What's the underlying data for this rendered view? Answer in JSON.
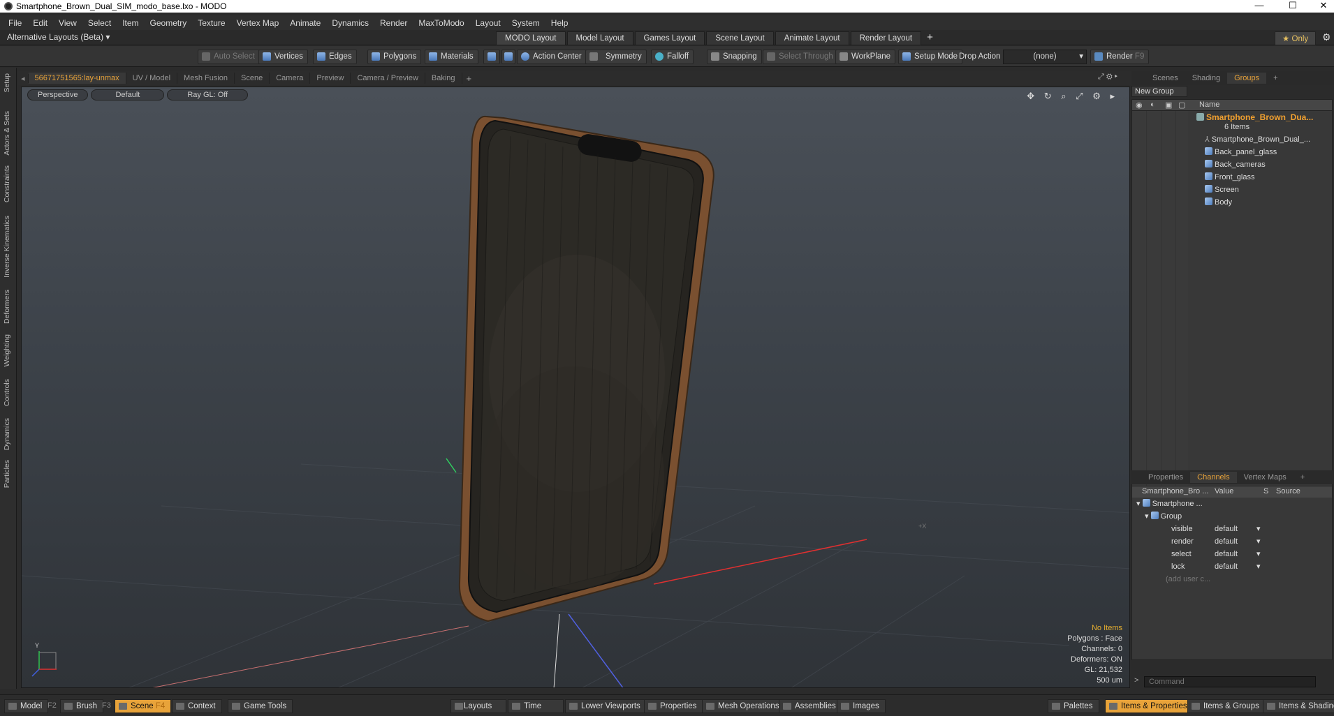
{
  "window": {
    "title": "Smartphone_Brown_Dual_SIM_modo_base.lxo - MODO",
    "controls": [
      "—",
      "☐",
      "✕"
    ]
  },
  "menu": [
    "File",
    "Edit",
    "View",
    "Select",
    "Item",
    "Geometry",
    "Texture",
    "Vertex Map",
    "Animate",
    "Dynamics",
    "Render",
    "MaxToModo",
    "Layout",
    "System",
    "Help"
  ],
  "layoutbar": {
    "alt_layouts": "Alternative Layouts (Beta) ▾",
    "tabs": [
      "MODO Layout",
      "Model Layout",
      "Games Layout",
      "Scene Layout",
      "Animate Layout",
      "Render Layout"
    ],
    "plus": "+",
    "only": "★ Only",
    "gear": "⚙"
  },
  "toolbar": {
    "auto_select": "Auto Select",
    "vertices": "Vertices",
    "edges": "Edges",
    "polygons": "Polygons",
    "materials": "Materials",
    "action_center": "Action Center",
    "symmetry": "Symmetry",
    "falloff": "Falloff",
    "snapping": "Snapping",
    "select_through": "Select Through",
    "workplane": "WorkPlane",
    "setup_mode": "Setup Mode",
    "drop_action": "Drop Action",
    "drop_value": "(none)",
    "render": "Render",
    "render_key": "F9"
  },
  "left_tabs": [
    "Setup",
    "Actors & Sets",
    "Constraints",
    "Inverse Kinematics",
    "Deformers",
    "Weighting",
    "Controls",
    "Dynamics",
    "Particles"
  ],
  "viewport_tabs": {
    "tabs": [
      "56671751565:lay-unmax",
      "UV / Model",
      "Mesh Fusion",
      "Scene",
      "Camera",
      "Preview",
      "Camera / Preview",
      "Baking"
    ],
    "plus": "+"
  },
  "viewport": {
    "perspective": "Perspective",
    "default": "Default",
    "raygl": "Ray GL: Off",
    "nav_icons": "✥ ↻ ⌕ ⤢ ⚙ ▸",
    "info": {
      "no_items": "No Items",
      "polygons": "Polygons : Face",
      "channels": "Channels: 0",
      "deformers": "Deformers: ON",
      "gl": "GL: 21,532",
      "scale": "500 um"
    },
    "axis_labels": {
      "y": "Y",
      "x": "+X"
    }
  },
  "groups_panel": {
    "tabs": [
      "Scenes",
      "Shading",
      "Groups"
    ],
    "plus": "+",
    "new_group": "New Group",
    "col_name": "Name",
    "group_title": "Smartphone_Brown_Dua...",
    "item_count": "6 Items",
    "items": [
      "Smartphone_Brown_Dual_...",
      "Back_panel_glass",
      "Back_cameras",
      "Front_glass",
      "Screen",
      "Body"
    ]
  },
  "channels_panel": {
    "tabs": [
      "Properties",
      "Channels",
      "Vertex Maps"
    ],
    "plus": "+",
    "headers": {
      "name": "Smartphone_Bro ...",
      "value": "Value",
      "s": "S",
      "source": "Source"
    },
    "root": "Smartphone ...",
    "group": "Group",
    "rows": [
      {
        "name": "visible",
        "value": "default"
      },
      {
        "name": "render",
        "value": "default"
      },
      {
        "name": "select",
        "value": "default"
      },
      {
        "name": "lock",
        "value": "default"
      }
    ],
    "add_user": "(add user c...",
    "command_placeholder": "Command"
  },
  "statusbar": {
    "model": "Model",
    "f2": "F2",
    "brush": "Brush",
    "f3": "F3",
    "scene": "Scene",
    "f4": "F4",
    "context": "Context",
    "game_tools": "Game Tools",
    "layouts": "Layouts",
    "time": "Time",
    "lower_viewports": "Lower Viewports",
    "properties": "Properties",
    "mesh_operations": "Mesh Operations",
    "assemblies": "Assemblies",
    "images": "Images",
    "palettes": "Palettes",
    "items_properties": "Items & Properties",
    "items_groups": "Items & Groups",
    "items_shading": "Items & Shading"
  },
  "colors": {
    "accent": "#e8a33a",
    "viewport_top": "#4a5058",
    "viewport_bottom": "#2f3338",
    "phone_frame": "#7a5030"
  }
}
